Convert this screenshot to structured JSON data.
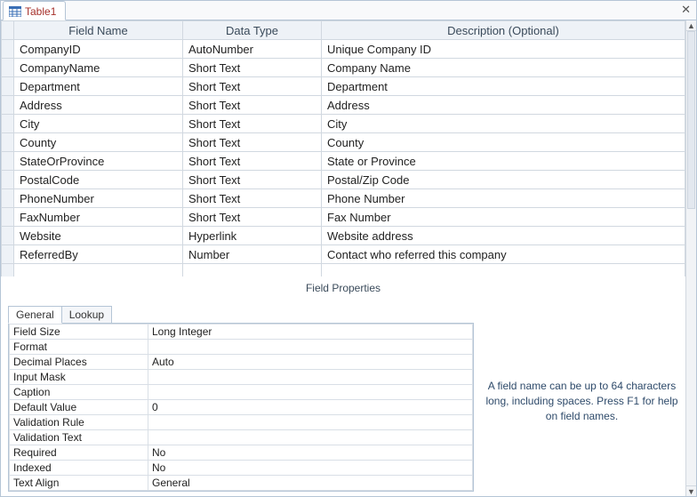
{
  "tab": {
    "label": "Table1"
  },
  "columns": {
    "field": "Field Name",
    "type": "Data Type",
    "desc": "Description (Optional)"
  },
  "rows": [
    {
      "field": "CompanyID",
      "type": "AutoNumber",
      "desc": "Unique Company ID"
    },
    {
      "field": "CompanyName",
      "type": "Short Text",
      "desc": "Company Name"
    },
    {
      "field": "Department",
      "type": "Short Text",
      "desc": "Department"
    },
    {
      "field": "Address",
      "type": "Short Text",
      "desc": "Address"
    },
    {
      "field": "City",
      "type": "Short Text",
      "desc": "City"
    },
    {
      "field": "County",
      "type": "Short Text",
      "desc": "County"
    },
    {
      "field": "StateOrProvince",
      "type": "Short Text",
      "desc": "State or Province"
    },
    {
      "field": "PostalCode",
      "type": "Short Text",
      "desc": "Postal/Zip Code"
    },
    {
      "field": "PhoneNumber",
      "type": "Short Text",
      "desc": "Phone Number"
    },
    {
      "field": "FaxNumber",
      "type": "Short Text",
      "desc": "Fax Number"
    },
    {
      "field": "Website",
      "type": "Hyperlink",
      "desc": "Website address"
    },
    {
      "field": "ReferredBy",
      "type": "Number",
      "desc": "Contact who referred this company"
    },
    {
      "field": "",
      "type": "",
      "desc": ""
    }
  ],
  "fpTitle": "Field Properties",
  "propTabs": {
    "general": "General",
    "lookup": "Lookup"
  },
  "props": [
    {
      "name": "Field Size",
      "value": "Long Integer"
    },
    {
      "name": "Format",
      "value": ""
    },
    {
      "name": "Decimal Places",
      "value": "Auto"
    },
    {
      "name": "Input Mask",
      "value": ""
    },
    {
      "name": "Caption",
      "value": ""
    },
    {
      "name": "Default Value",
      "value": "0"
    },
    {
      "name": "Validation Rule",
      "value": ""
    },
    {
      "name": "Validation Text",
      "value": ""
    },
    {
      "name": "Required",
      "value": "No"
    },
    {
      "name": "Indexed",
      "value": "No"
    },
    {
      "name": "Text Align",
      "value": "General"
    }
  ],
  "help": "A field name can be up to 64 characters long, including spaces. Press F1 for help on field names."
}
